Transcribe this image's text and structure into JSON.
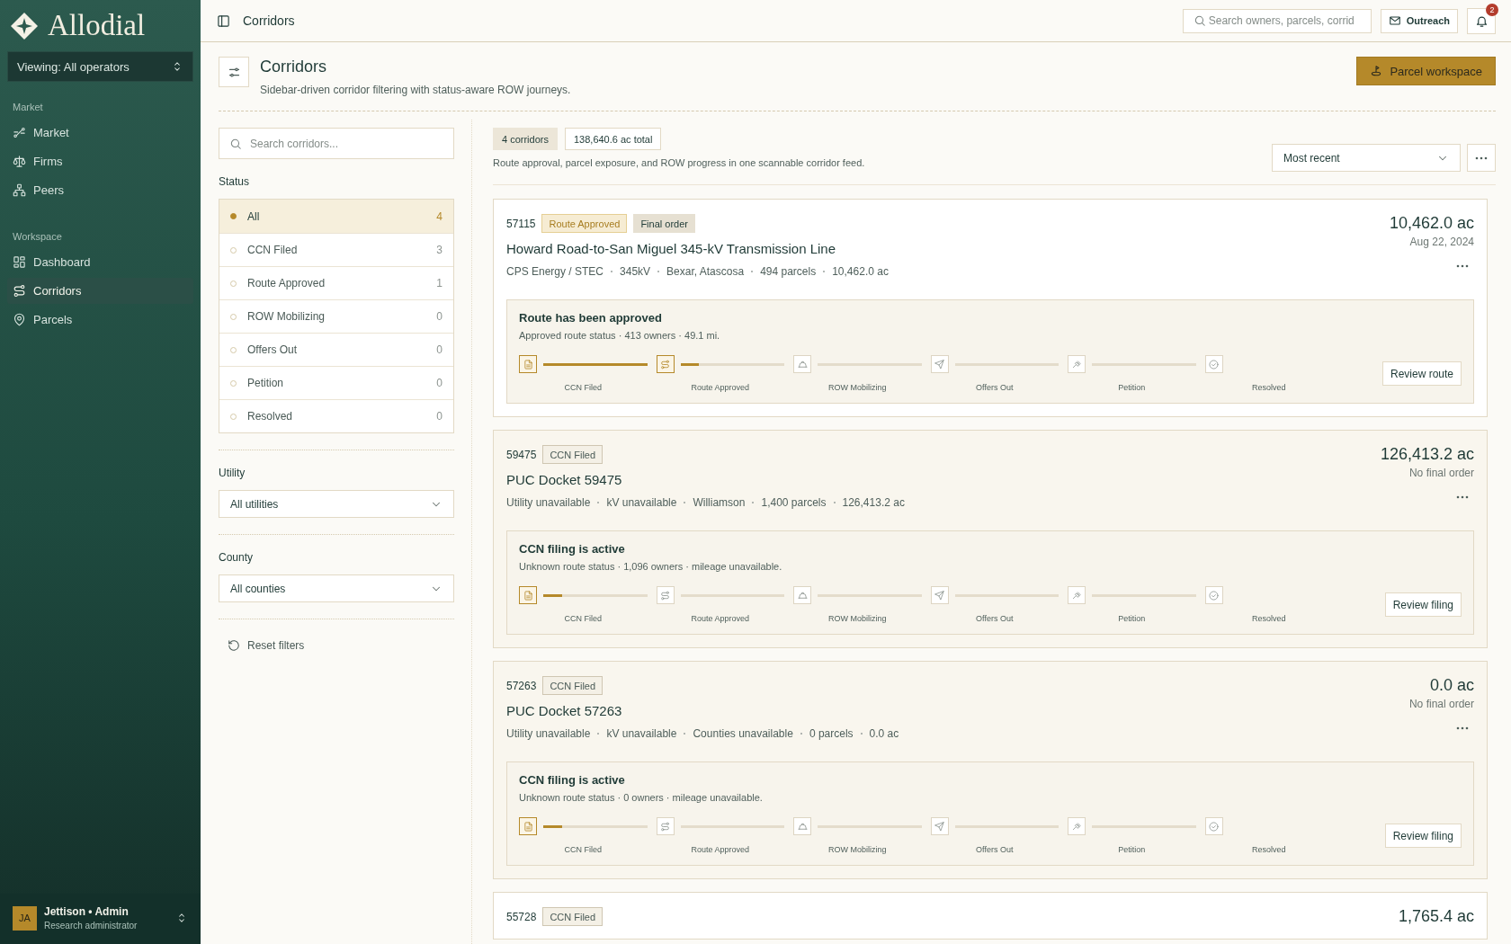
{
  "brand": {
    "name": "Allodial"
  },
  "scope_select": {
    "value": "Viewing: All operators"
  },
  "nav_sections": [
    {
      "heading": "Market",
      "items": [
        {
          "label": "Market",
          "selected": false
        },
        {
          "label": "Firms",
          "selected": false
        },
        {
          "label": "Peers",
          "selected": false
        }
      ]
    },
    {
      "heading": "Workspace",
      "items": [
        {
          "label": "Dashboard",
          "selected": false
        },
        {
          "label": "Corridors",
          "selected": true
        },
        {
          "label": "Parcels",
          "selected": false
        }
      ]
    }
  ],
  "user": {
    "initials": "JA",
    "name": "Jettison • Admin",
    "role": "Research administrator"
  },
  "topbar": {
    "title": "Corridors",
    "search": {
      "placeholder": "Search owners, parcels, corrid"
    },
    "outreach": "Outreach",
    "notifications": "2"
  },
  "page_header": {
    "title": "Corridors",
    "subtitle": "Sidebar-driven corridor filtering with status-aware ROW journeys.",
    "action": "Parcel workspace"
  },
  "filters": {
    "search": {
      "placeholder": "Search corridors..."
    },
    "status": {
      "heading": "Status",
      "items": [
        {
          "label": "All",
          "count": "4",
          "selected": true
        },
        {
          "label": "CCN Filed",
          "count": "3",
          "selected": false
        },
        {
          "label": "Route Approved",
          "count": "1",
          "selected": false
        },
        {
          "label": "ROW Mobilizing",
          "count": "0",
          "selected": false
        },
        {
          "label": "Offers Out",
          "count": "0",
          "selected": false
        },
        {
          "label": "Petition",
          "count": "0",
          "selected": false
        },
        {
          "label": "Resolved",
          "count": "0",
          "selected": false
        }
      ]
    },
    "utility": {
      "heading": "Utility",
      "value": "All utilities"
    },
    "county": {
      "heading": "County",
      "value": "All counties"
    },
    "reset": "Reset filters"
  },
  "feed": {
    "chips": [
      {
        "label": "4 corridors",
        "kind": "filled"
      },
      {
        "label": "138,640.6 ac total",
        "kind": "outline"
      }
    ],
    "caption": "Route approval, parcel exposure, and ROW progress in one scannable corridor feed.",
    "sort": "Most recent"
  },
  "corridors": [
    {
      "id": "57115",
      "badges": [
        {
          "label": "Route Approved",
          "kind": "highlight"
        },
        {
          "label": "Final order",
          "kind": "filled"
        }
      ],
      "title": "Howard Road-to-San Miguel 345-kV Transmission Line",
      "meta": [
        "CPS Energy / STEC",
        "345kV",
        "Bexar, Atascosa",
        "494 parcels",
        "10,462.0 ac"
      ],
      "acreage": "10,462.0 ac",
      "date": "Aug 22, 2024",
      "panel": {
        "headline": "Route has been approved",
        "detail": "Approved route status · 413 owners · 49.1 mi.",
        "action": "Review route",
        "steps": [
          {
            "label": "CCN Filed",
            "active": true,
            "level": 1
          },
          {
            "label": "Route Approved",
            "active": true,
            "level": 0.18
          },
          {
            "label": "ROW Mobilizing",
            "active": false,
            "level": 0
          },
          {
            "label": "Offers Out",
            "active": false,
            "level": 0
          },
          {
            "label": "Petition",
            "active": false,
            "level": 0
          },
          {
            "label": "Resolved",
            "active": false
          }
        ]
      }
    },
    {
      "id": "59475",
      "badges": [
        {
          "label": "CCN Filed",
          "kind": "outline"
        }
      ],
      "title": "PUC Docket 59475",
      "meta": [
        "Utility unavailable",
        "kV unavailable",
        "Williamson",
        "1,400 parcels",
        "126,413.2 ac"
      ],
      "acreage": "126,413.2 ac",
      "date": "No final order",
      "panel": {
        "headline": "CCN filing is active",
        "detail": "Unknown route status · 1,096 owners · mileage unavailable.",
        "action": "Review filing",
        "steps": [
          {
            "label": "CCN Filed",
            "active": true,
            "level": 0.18
          },
          {
            "label": "Route Approved",
            "active": false,
            "level": 0
          },
          {
            "label": "ROW Mobilizing",
            "active": false,
            "level": 0
          },
          {
            "label": "Offers Out",
            "active": false,
            "level": 0
          },
          {
            "label": "Petition",
            "active": false,
            "level": 0
          },
          {
            "label": "Resolved",
            "active": false
          }
        ]
      }
    },
    {
      "id": "57263",
      "badges": [
        {
          "label": "CCN Filed",
          "kind": "outline"
        }
      ],
      "title": "PUC Docket 57263",
      "meta": [
        "Utility unavailable",
        "kV unavailable",
        "Counties unavailable",
        "0 parcels",
        "0.0 ac"
      ],
      "acreage": "0.0 ac",
      "date": "No final order",
      "panel": {
        "headline": "CCN filing is active",
        "detail": "Unknown route status · 0 owners · mileage unavailable.",
        "action": "Review filing",
        "steps": [
          {
            "label": "CCN Filed",
            "active": true,
            "level": 0.18
          },
          {
            "label": "Route Approved",
            "active": false,
            "level": 0
          },
          {
            "label": "ROW Mobilizing",
            "active": false,
            "level": 0
          },
          {
            "label": "Offers Out",
            "active": false,
            "level": 0
          },
          {
            "label": "Petition",
            "active": false,
            "level": 0
          },
          {
            "label": "Resolved",
            "active": false
          }
        ]
      }
    },
    {
      "id": "55728",
      "badges": [
        {
          "label": "CCN Filed",
          "kind": "outline"
        }
      ],
      "acreage": "1,765.4 ac"
    }
  ]
}
